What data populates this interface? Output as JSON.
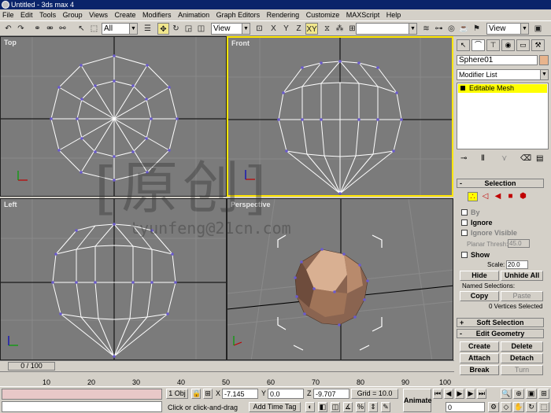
{
  "window": {
    "title": "Untitled - 3ds max 4"
  },
  "menu": [
    "File",
    "Edit",
    "Tools",
    "Group",
    "Views",
    "Create",
    "Modifiers",
    "Animation",
    "Graph Editors",
    "Rendering",
    "Customize",
    "MAXScript",
    "Help"
  ],
  "toolbar": {
    "selection_filter": "All",
    "ref_coord": "View",
    "view_combo": "View",
    "axis_x": "X",
    "axis_y": "Y",
    "axis_z": "Z",
    "axis_xy": "XY"
  },
  "viewports": {
    "top": "Top",
    "front": "Front",
    "left": "Left",
    "perspective": "Perspective"
  },
  "watermark": {
    "main": "[原创]",
    "sub": "tyunfeng@21cn.com"
  },
  "panel": {
    "object_name": "Sphere01",
    "modifier_list": "Modifier List",
    "stack_item": "Editable Mesh",
    "selection": {
      "title": "Selection",
      "by": "By",
      "ignore": "Ignore",
      "ignore_visible": "Ignore Visible",
      "planar_thresh_label": "Planar Thresh:",
      "planar_thresh": "45.0",
      "show": "Show",
      "scale_label": "Scale:",
      "scale": "20.0",
      "hide": "Hide",
      "unhide_all": "Unhide All",
      "named_selections": "Named Selections:",
      "copy": "Copy",
      "paste": "Paste",
      "status": "0 Vertices Selected"
    },
    "soft_selection": "Soft Selection",
    "edit_geometry": {
      "title": "Edit Geometry",
      "create": "Create",
      "delete": "Delete",
      "attach": "Attach",
      "detach": "Detach",
      "break": "Break",
      "turn": "Turn"
    }
  },
  "timeline": {
    "slider": "0 / 100",
    "ticks": [
      "10",
      "20",
      "30",
      "40",
      "50",
      "60",
      "70",
      "80",
      "90",
      "100"
    ]
  },
  "status": {
    "selected": "1 Obj",
    "x_label": "X",
    "x_value": "-7.145",
    "y_label": "Y",
    "y_value": "0.0",
    "z_label": "Z",
    "z_value": "-9.707",
    "grid": "Grid = 10.0",
    "prompt": "Click or click-and-drag",
    "add_time_tag": "Add Time Tag",
    "animate": "Animate",
    "frame": "0"
  }
}
